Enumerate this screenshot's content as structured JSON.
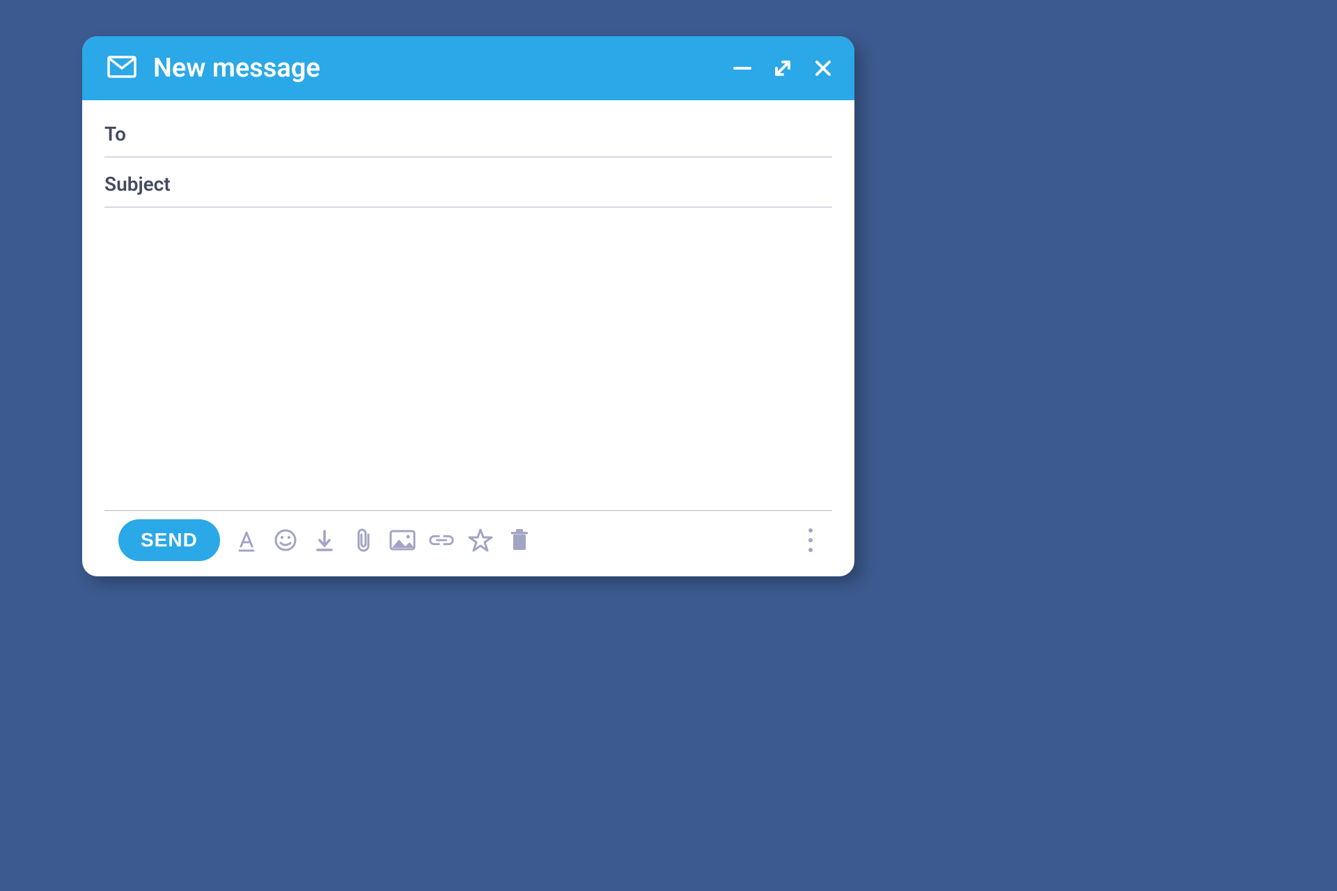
{
  "header": {
    "title": "New message"
  },
  "fields": {
    "to_label": "To",
    "to_value": "",
    "subject_label": "Subject",
    "subject_value": "",
    "body_value": ""
  },
  "toolbar": {
    "send_label": "SEND"
  },
  "colors": {
    "background": "#3c5a8f",
    "accent": "#2aa8e8",
    "muted_icon": "#a1a4c4",
    "text": "#444b60",
    "divider": "#b5b6cf"
  }
}
